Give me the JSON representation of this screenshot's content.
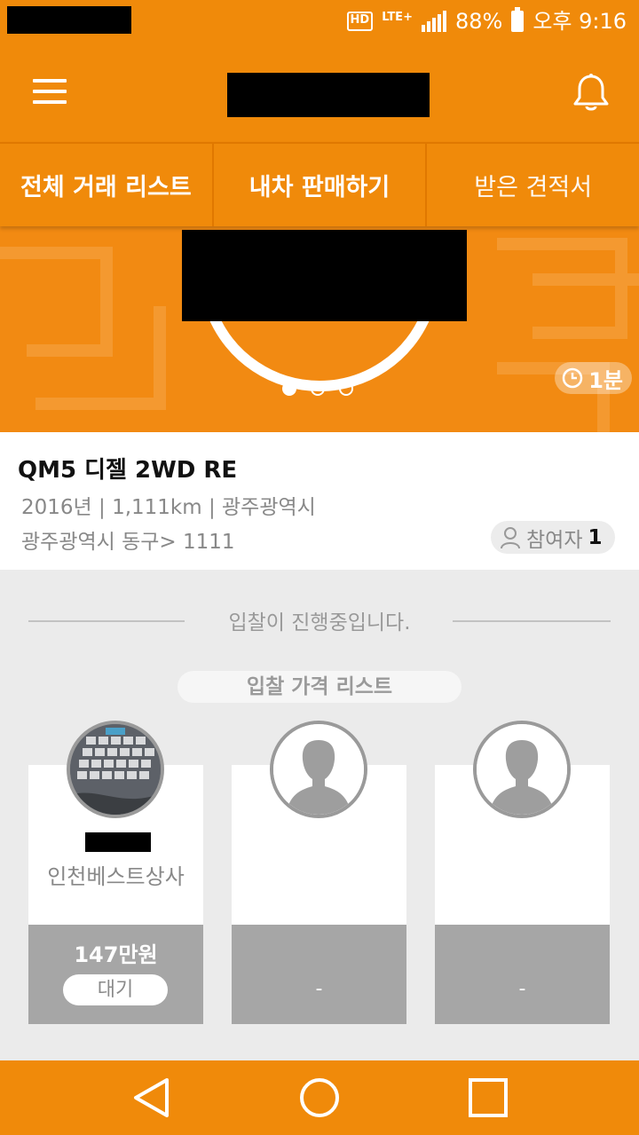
{
  "status_bar": {
    "hd_label": "HD",
    "network_label": "LTE+",
    "battery": "88%",
    "time": "오후 9:16"
  },
  "app_bar": {
    "menu_icon": "hamburger-menu-icon",
    "notification_icon": "bell-icon"
  },
  "tabs": [
    {
      "label": "전체 거래 리스트"
    },
    {
      "label": "내차 판매하기"
    },
    {
      "label": "받은 견적서"
    }
  ],
  "banner": {
    "slide_count": 3,
    "active_slide": 0,
    "time_remaining": "1분"
  },
  "listing": {
    "title": "QM5 디젤 2WD RE",
    "meta": "2016년 | 1,111km | 광주광역시",
    "address": "광주광역시 동구> 1111",
    "participants_label": "참여자",
    "participants_count": "1"
  },
  "bidding": {
    "status_text": "입찰이 진행중입니다.",
    "list_title": "입찰 가격 리스트",
    "bids": [
      {
        "dealer": "인천베스트상사",
        "price": "147만원",
        "status": "대기"
      },
      {
        "placeholder": "-"
      },
      {
        "placeholder": "-"
      }
    ]
  },
  "colors": {
    "brand_orange": "#f08a0a",
    "card_gray": "#a6a6a6",
    "background": "#ebebeb"
  }
}
